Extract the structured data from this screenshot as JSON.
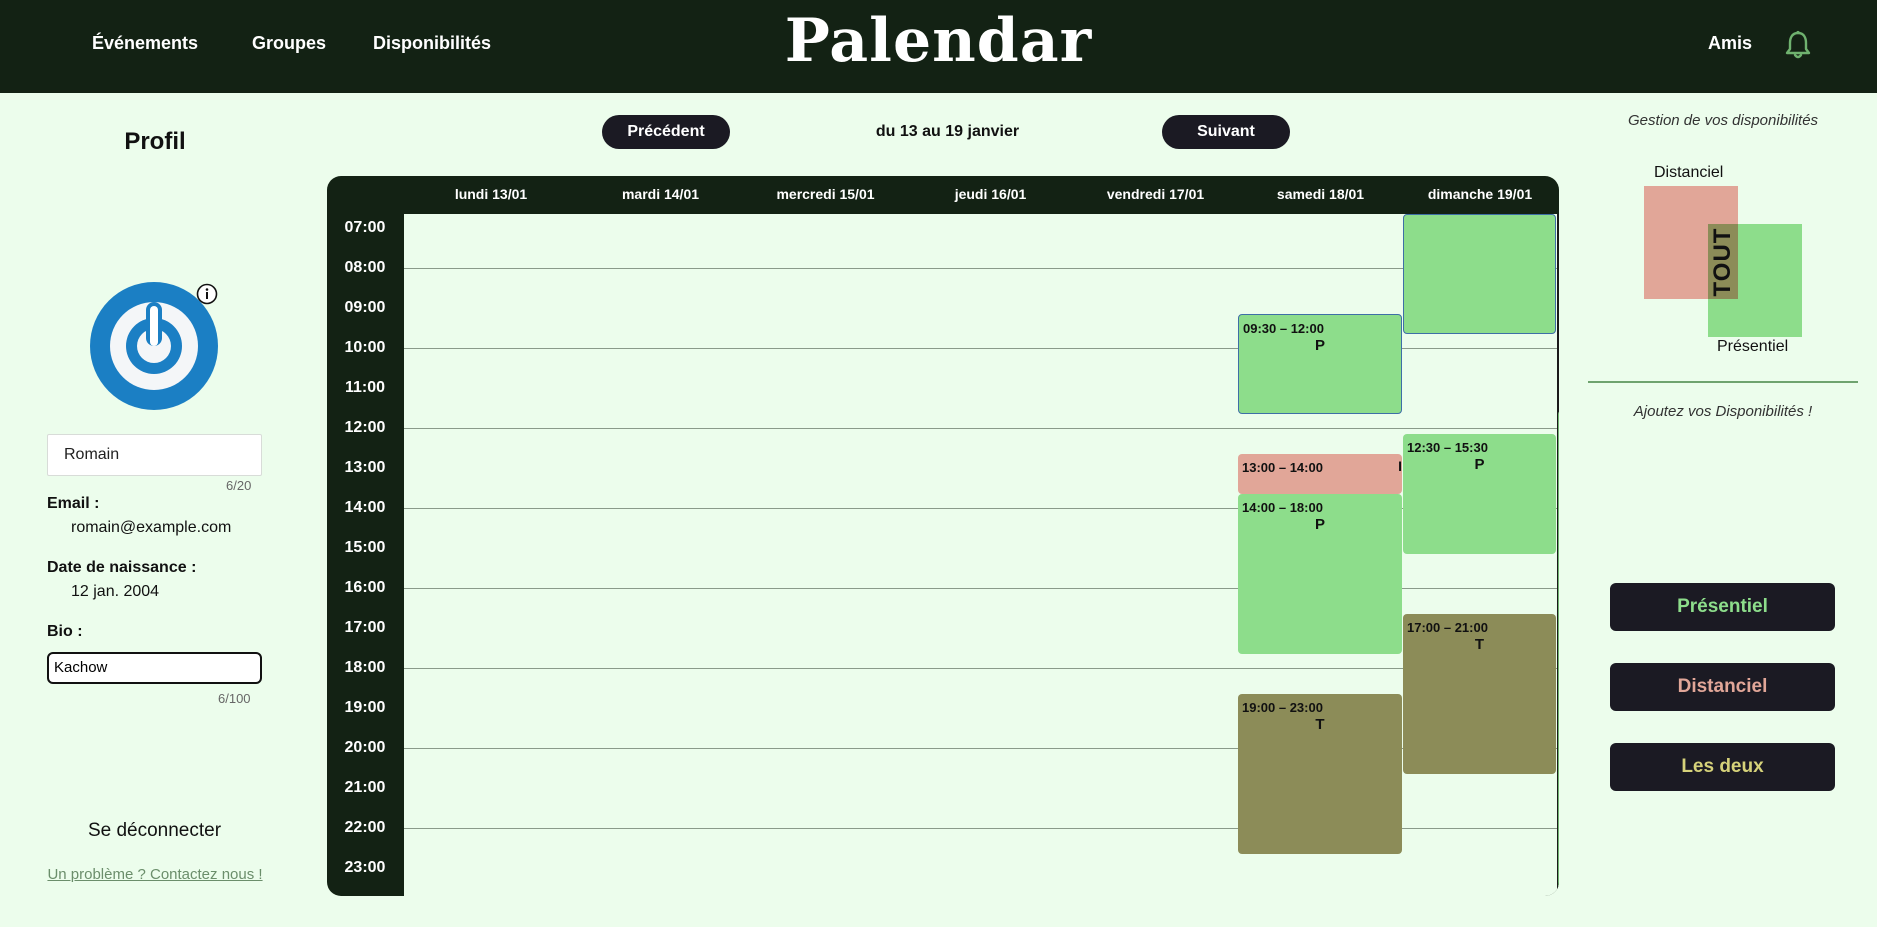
{
  "nav": {
    "links": [
      "Événements",
      "Groupes",
      "Disponibilités"
    ],
    "brand": "Palendar",
    "friends": "Amis",
    "bell_icon": "bell-icon"
  },
  "profile": {
    "title": "Profil",
    "avatar_icon": "power-icon",
    "info_icon": "info-icon",
    "name_value": "Romain",
    "name_counter": "6/20",
    "email_label": "Email :",
    "email_value": "romain@example.com",
    "birth_label": "Date de naissance :",
    "birth_value": "12 jan. 2004",
    "bio_label": "Bio :",
    "bio_value": "Kachow",
    "bio_counter": "6/100",
    "logout": "Se déconnecter",
    "contact": "Un problème ? Contactez nous !"
  },
  "week": {
    "prev": "Précédent",
    "range": "du 13 au 19 janvier",
    "next": "Suivant"
  },
  "calendar": {
    "days": [
      "lundi 13/01",
      "mardi 14/01",
      "mercredi 15/01",
      "jeudi 16/01",
      "vendredi 17/01",
      "samedi 18/01",
      "dimanche 19/01"
    ],
    "hours": [
      "07:00",
      "08:00",
      "09:00",
      "10:00",
      "11:00",
      "12:00",
      "13:00",
      "14:00",
      "15:00",
      "16:00",
      "17:00",
      "18:00",
      "19:00",
      "20:00",
      "21:00",
      "22:00",
      "23:00"
    ],
    "events": [
      {
        "day": 6,
        "start": 7.0,
        "end": 10.0,
        "color": "green",
        "time": "",
        "type": "",
        "selected": true
      },
      {
        "day": 5,
        "start": 9.5,
        "end": 12.0,
        "color": "green",
        "time": "09:30 – 12:00",
        "type": "P",
        "selected": true
      },
      {
        "day": 5,
        "start": 13.0,
        "end": 14.0,
        "color": "red",
        "time": "13:00 – 14:00",
        "type": "",
        "trail": "I"
      },
      {
        "day": 6,
        "start": 12.5,
        "end": 15.5,
        "color": "green",
        "time": "12:30 – 15:30",
        "type": "P"
      },
      {
        "day": 5,
        "start": 14.0,
        "end": 18.0,
        "color": "green",
        "time": "14:00 – 18:00",
        "type": "P"
      },
      {
        "day": 6,
        "start": 17.0,
        "end": 21.0,
        "color": "olive",
        "time": "17:00 – 21:00",
        "type": "T"
      },
      {
        "day": 5,
        "start": 19.0,
        "end": 23.0,
        "color": "olive",
        "time": "19:00 – 23:00",
        "type": "T"
      }
    ]
  },
  "panel": {
    "title": "Gestion de vos disponibilités",
    "distanciel": "Distanciel",
    "presentiel": "Présentiel",
    "tout": "TOUT",
    "subtitle": "Ajoutez vos Disponibilités !",
    "buttons": [
      {
        "label": "Présentiel",
        "color": "#8ddd8b"
      },
      {
        "label": "Distanciel",
        "color": "#e1a698"
      },
      {
        "label": "Les deux",
        "color": "#d6d27a"
      }
    ]
  },
  "colors": {
    "header": "#132214",
    "background": "#ecfdec",
    "presentiel": "#8ddd8b",
    "distanciel": "#e1a698",
    "both": "#8c8c58"
  }
}
